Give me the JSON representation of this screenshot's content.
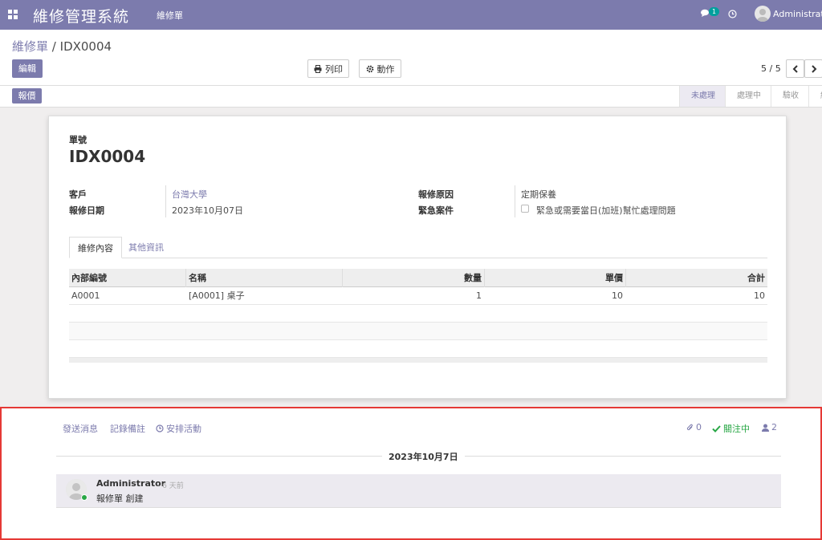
{
  "navbar": {
    "brand": "維修管理系統",
    "menu": "維修單",
    "chat_count": "1",
    "user_name": "Administrator"
  },
  "control": {
    "breadcrumb_parent": "維修單",
    "breadcrumb_sep": "/",
    "breadcrumb_current": "IDX0004",
    "edit_label": "編輯",
    "print_label": "列印",
    "action_label": "動作",
    "pager": "5 / 5"
  },
  "statusbar": {
    "quote_label": "報價",
    "stages": [
      "未處理",
      "處理中",
      "驗收",
      "結案"
    ],
    "active_stage": "未處理"
  },
  "form": {
    "doc_label": "單號",
    "doc_number": "IDX0004",
    "customer_label": "客戶",
    "customer_value": "台灣大學",
    "date_label": "報修日期",
    "date_value": "2023年10月07日",
    "reason_label": "報修原因",
    "reason_value": "定期保養",
    "urgent_label": "緊急案件",
    "urgent_text": "緊急或需要當日(加班)幫忙處理問題",
    "urgent_checked": false
  },
  "tabs": {
    "active": "維修內容",
    "inactive": "其他資訊"
  },
  "grid": {
    "headers": [
      "內部編號",
      "名稱",
      "數量",
      "單價",
      "合計"
    ],
    "rows": [
      [
        "A0001",
        "[A0001] 桌子",
        "1",
        "10",
        "10"
      ]
    ]
  },
  "chatter": {
    "send_message": "發送消息",
    "log_note": "記錄備註",
    "schedule_activity": "安排活動",
    "attachments": "0",
    "following": "關注中",
    "followers": "2",
    "date_separator": "2023年10月7日",
    "message": {
      "author": "Administrator",
      "time": "- 6 天前",
      "body": "報修單 創建"
    }
  },
  "colors": {
    "brand": "#7c7bad",
    "following": "#28a745",
    "highlight_border": "#e53935"
  }
}
